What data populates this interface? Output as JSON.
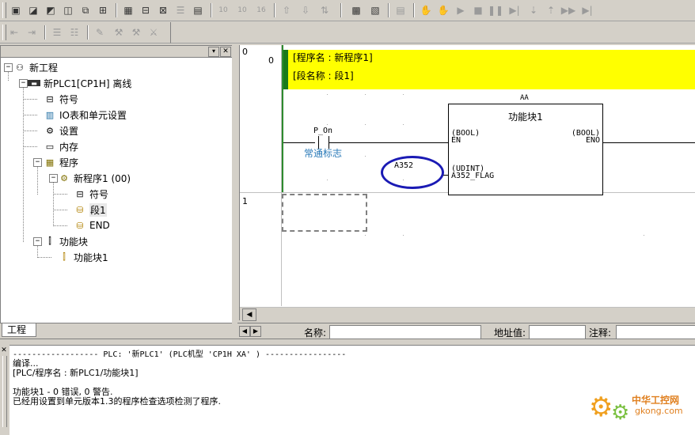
{
  "tree": {
    "tab_label": "工程",
    "items": [
      {
        "label": "新工程"
      },
      {
        "label": "新PLC1[CP1H] 离线"
      },
      {
        "label": "符号"
      },
      {
        "label": "IO表和单元设置"
      },
      {
        "label": "设置"
      },
      {
        "label": "内存"
      },
      {
        "label": "程序"
      },
      {
        "label": "新程序1 (00)"
      },
      {
        "label": "符号"
      },
      {
        "label": "段1"
      },
      {
        "label": "END"
      },
      {
        "label": "功能块"
      },
      {
        "label": "功能块1"
      }
    ]
  },
  "ladder": {
    "rung0_num": "0",
    "rung0_step": "0",
    "program_name": "[程序名 : 新程序1]",
    "section_name": "[段名称 : 段1]",
    "fb_instance": "AA",
    "fb_title": "功能块1",
    "fb_in_en_type": "(BOOL)",
    "fb_in_en": "EN",
    "fb_out_eno_type": "(BOOL)",
    "fb_out_eno": "ENO",
    "fb_in2_type": "(UDINT)",
    "fb_in2_name": "A352_FLAG",
    "contact_name": "P_On",
    "contact_comment": "常通标志",
    "annotation_text": "A352",
    "rung1_num": "1",
    "highlight_color": "#ffff00",
    "marker_color": "#1a7a1a",
    "circle_color": "#1a1ab4"
  },
  "statusbar": {
    "name_label": "名称:",
    "address_label": "地址值:",
    "comment_label": "注释:"
  },
  "output": {
    "lines": [
      "------------------ PLC: '新PLC1' (PLC机型 'CP1H XA' ) -----------------",
      "编译...",
      "[PLC/程序名 : 新PLC1/功能块1]",
      "",
      "功能块1 - 0 错误, 0 警告.",
      "已经用设置到单元版本1.3的程序检查选项检测了程序."
    ]
  },
  "watermark": {
    "text1": "中华工控网",
    "text2": "gkong.com"
  }
}
